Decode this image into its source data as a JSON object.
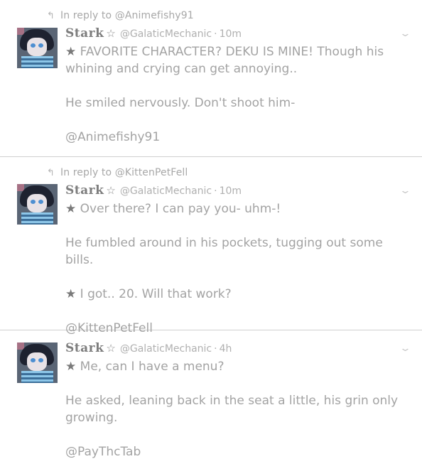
{
  "tweets": [
    {
      "reply_to": "In reply to @Animefishy91",
      "display_name": "Stark",
      "handle": "@GalaticMechanic",
      "time": "10m",
      "lines": [
        "FAVORITE CHARACTER? DEKU IS MINE! Though his whining and crying can get annoying..",
        "He smiled nervously. Don't shoot him-",
        "@Animefishy91"
      ]
    },
    {
      "reply_to": "In reply to @KittenPetFell",
      "display_name": "Stark",
      "handle": "@GalaticMechanic",
      "time": "10m",
      "lines": [
        "Over there? I can pay you- uhm-!",
        "He fumbled around in his pockets, tugging out some bills.",
        "I got.. 20. Will that work?",
        "@KittenPetFell"
      ]
    },
    {
      "reply_to": "",
      "display_name": "Stark",
      "handle": "@GalaticMechanic",
      "time": "4h",
      "lines": [
        "Me, can I have a menu?",
        "He asked, leaning back in the seat a little, his grin only growing.",
        "@PayThcTab"
      ]
    }
  ],
  "icons": {
    "reply": "reply-arrow-icon",
    "star": "star-outline-icon",
    "menu": "chevron-down-icon",
    "bullet": "black-star-glyph"
  }
}
